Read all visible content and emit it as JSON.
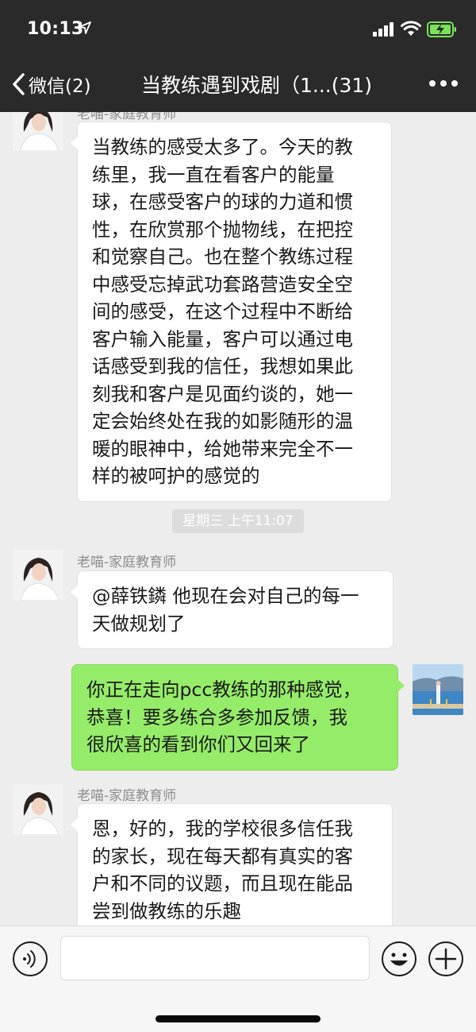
{
  "status_bar": {
    "time": "10:13"
  },
  "nav": {
    "back_label": "微信(2)",
    "title": "当教练遇到戏剧（1...(31)"
  },
  "messages": [
    {
      "sender": "老喵-家庭教育师",
      "text": "当教练的感受太多了。今天的教\n练里，我一直在看客户的能量\n球，在感受客户的球的力道和惯\n性，在欣赏那个抛物线，在把控\n和觉察自己。也在整个教练过程\n中感受忘掉武功套路营造安全空\n间的感受，在这个过程中不断给\n客户输入能量，客户可以通过电\n话感受到我的信任，我想如果此\n刻我和客户是见面约谈的，她一\n定会始终处在我的如影随形的温\n暖的眼神中，给她带来完全不一\n样的被呵护的感觉的"
    },
    {
      "sender": "老喵-家庭教育师",
      "text": "@薛铁鏻 他现在会对自己的每一\n天做规划了"
    },
    {
      "sender": "",
      "text": "你正在走向pcc教练的那种感觉，\n恭喜！要多练合多参加反馈，我\n很欣喜的看到你们又回来了"
    },
    {
      "sender": "老喵-家庭教育师",
      "text": "恩，好的，我的学校很多信任我\n的家长，现在每天都有真实的客\n户和不同的议题，而且现在能品\n尝到做教练的乐趣"
    }
  ],
  "timestamp": "星期三 上午11:07",
  "colors": {
    "header_bg": "#2a2a2a",
    "chat_bg": "#ededed",
    "own_bubble": "#95ec69",
    "other_bubble": "#ffffff",
    "battery": "#7be05a"
  },
  "icons": {
    "back": "chevron-left-icon",
    "more": "more-dots-icon",
    "voice": "voice-icon",
    "emoji": "emoji-icon",
    "plus": "plus-icon"
  }
}
